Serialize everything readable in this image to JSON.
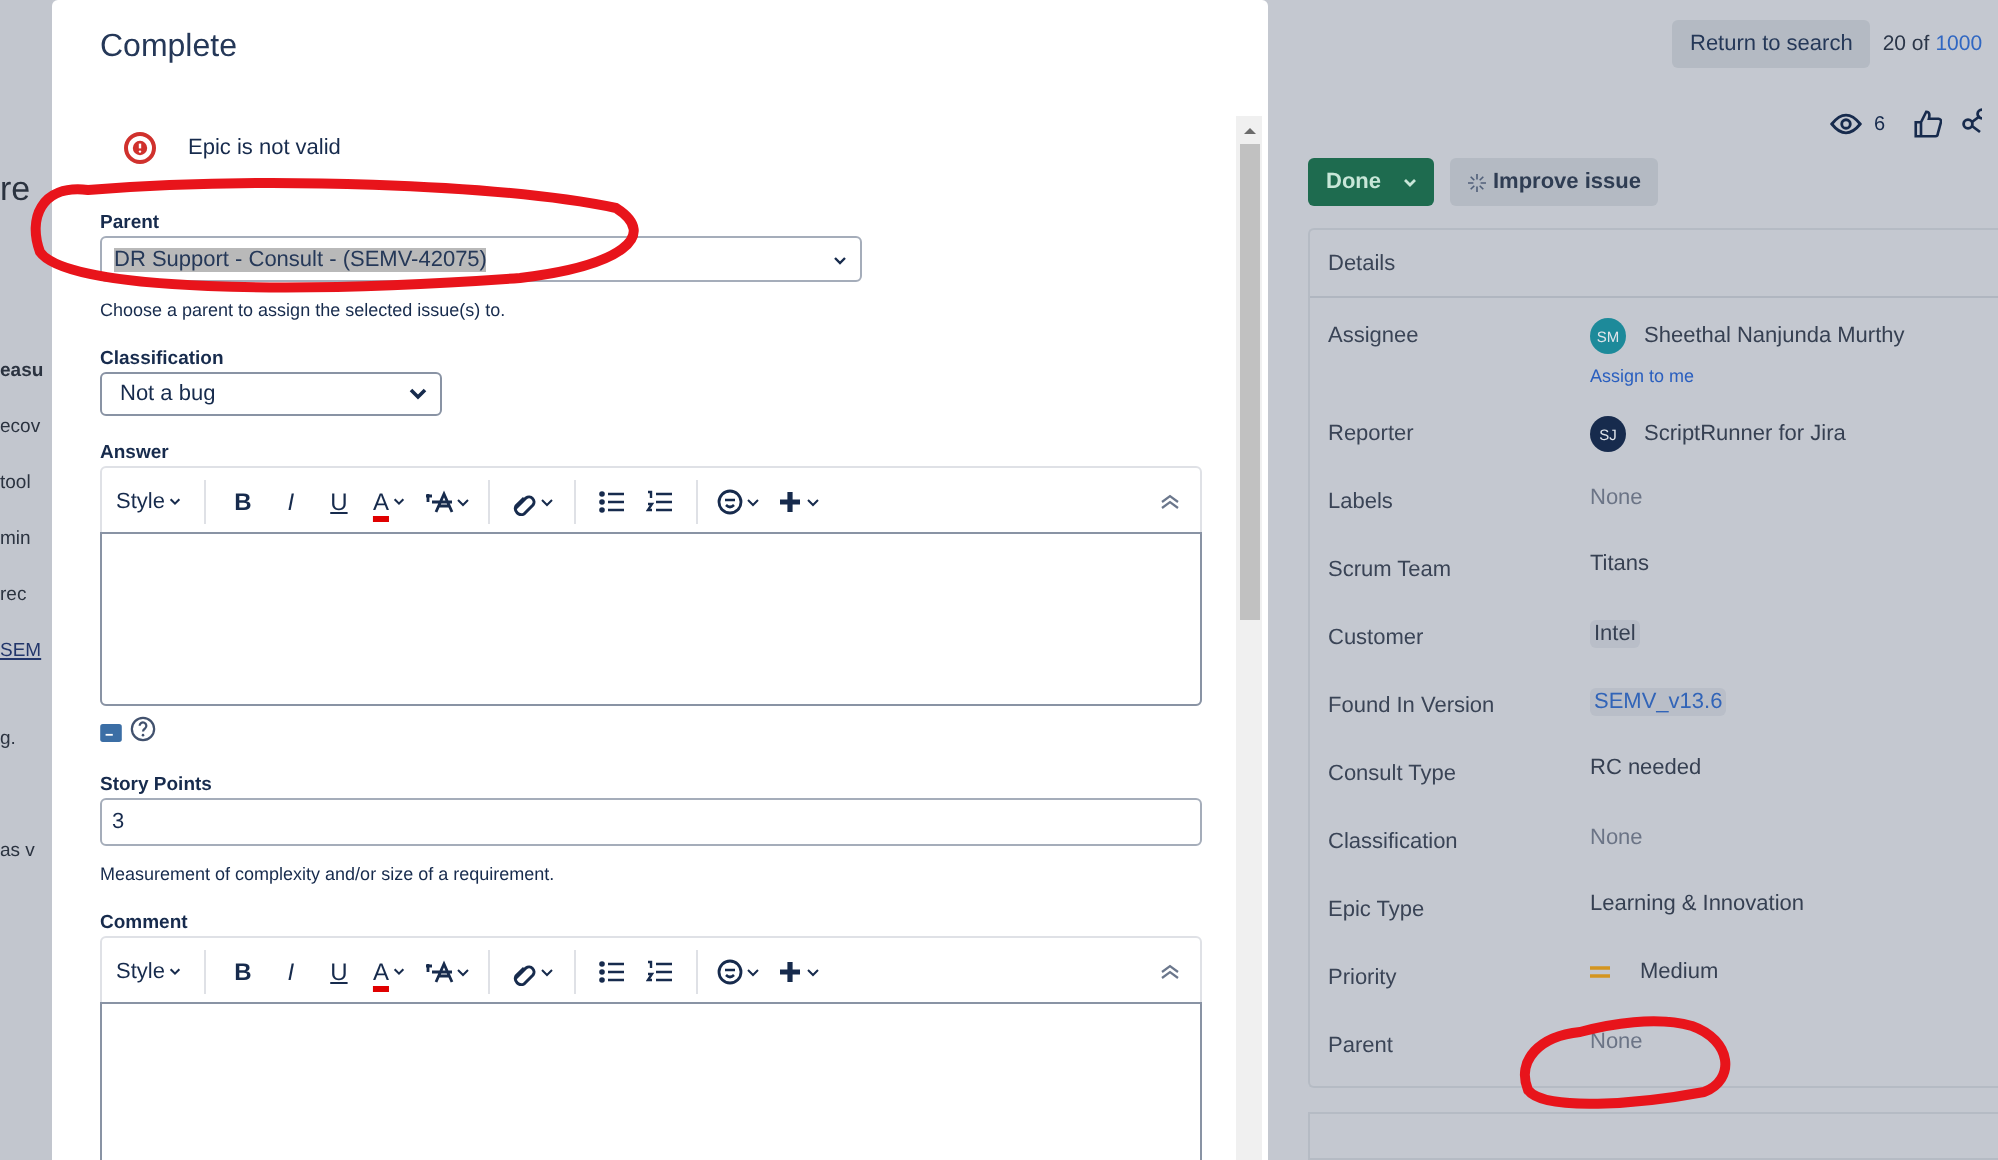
{
  "background_fragments": [
    {
      "kind": "heading",
      "text": "re"
    },
    {
      "kind": "bold",
      "text": "easu"
    },
    {
      "kind": "text",
      "text": "ecov"
    },
    {
      "kind": "text",
      "text": "tool"
    },
    {
      "kind": "text",
      "text": "min"
    },
    {
      "kind": "text",
      "text": "rec"
    },
    {
      "kind": "link",
      "text": "SEM"
    },
    {
      "kind": "text",
      "text": "g."
    },
    {
      "kind": "text",
      "text": "as v"
    }
  ],
  "dialog": {
    "title": "Complete",
    "error": "Epic is not valid",
    "parent": {
      "label": "Parent",
      "value": "DR Support - Consult - (SEMV-42075)",
      "help": "Choose a parent to assign the selected issue(s) to."
    },
    "classification": {
      "label": "Classification",
      "value": "Not a bug"
    },
    "answer": {
      "label": "Answer",
      "toolbar": {
        "style": "Style",
        "bold": "B",
        "italic": "I",
        "underline": "U",
        "font_colour_letter": "A"
      }
    },
    "story_points": {
      "label": "Story Points",
      "value": "3",
      "help": "Measurement of complexity and/or size of a requirement."
    },
    "comment": {
      "label": "Comment",
      "toolbar": {
        "style": "Style",
        "bold": "B",
        "italic": "I",
        "underline": "U",
        "font_colour_letter": "A"
      }
    }
  },
  "issue": {
    "return_button": "Return to search",
    "position": "20 of",
    "position_total": "1000",
    "watchers": "6",
    "status": "Done",
    "improve_button": "Improve issue",
    "details": {
      "title": "Details",
      "rows": [
        {
          "label": "Assignee",
          "kind": "user",
          "value": "Sheethal Nanjunda Murthy",
          "initials": "SM",
          "color": "#1d8a9a",
          "action": "Assign to me"
        },
        {
          "label": "Reporter",
          "kind": "user",
          "value": "ScriptRunner for Jira",
          "initials": "SJ",
          "color": "#172b4d"
        },
        {
          "label": "Labels",
          "kind": "none",
          "value": "None"
        },
        {
          "label": "Scrum Team",
          "kind": "text",
          "value": "Titans"
        },
        {
          "label": "Customer",
          "kind": "tag",
          "value": "Intel"
        },
        {
          "label": "Found In Version",
          "kind": "link-tag",
          "value": "SEMV_v13.6"
        },
        {
          "label": "Consult Type",
          "kind": "text",
          "value": "RC needed"
        },
        {
          "label": "Classification",
          "kind": "none",
          "value": "None"
        },
        {
          "label": "Epic Type",
          "kind": "text",
          "value": "Learning & Innovation"
        },
        {
          "label": "Priority",
          "kind": "priority",
          "value": "Medium"
        },
        {
          "label": "Parent",
          "kind": "none",
          "value": "None"
        }
      ]
    }
  }
}
